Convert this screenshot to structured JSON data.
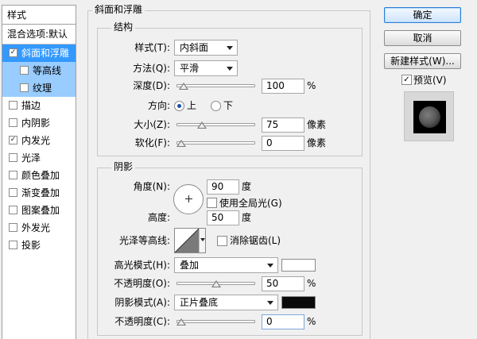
{
  "left_panel": {
    "title": "样式",
    "blend_options": "混合选项:默认",
    "items": [
      {
        "label": "斜面和浮雕",
        "checked": true,
        "selected": true,
        "sub": false
      },
      {
        "label": "等高线",
        "checked": false,
        "selected": false,
        "sub": true
      },
      {
        "label": "纹理",
        "checked": false,
        "selected": false,
        "sub": true
      },
      {
        "label": "描边",
        "checked": false,
        "selected": false,
        "sub": false
      },
      {
        "label": "内阴影",
        "checked": false,
        "selected": false,
        "sub": false
      },
      {
        "label": "内发光",
        "checked": true,
        "selected": false,
        "sub": false
      },
      {
        "label": "光泽",
        "checked": false,
        "selected": false,
        "sub": false
      },
      {
        "label": "颜色叠加",
        "checked": false,
        "selected": false,
        "sub": false
      },
      {
        "label": "渐变叠加",
        "checked": false,
        "selected": false,
        "sub": false
      },
      {
        "label": "图案叠加",
        "checked": false,
        "selected": false,
        "sub": false
      },
      {
        "label": "外发光",
        "checked": false,
        "selected": false,
        "sub": false
      },
      {
        "label": "投影",
        "checked": false,
        "selected": false,
        "sub": false
      }
    ]
  },
  "bevel": {
    "title": "斜面和浮雕",
    "structure": {
      "title": "结构",
      "style_label": "样式(T):",
      "style_value": "内斜面",
      "technique_label": "方法(Q):",
      "technique_value": "平滑",
      "depth_label": "深度(D):",
      "depth_value": "100",
      "depth_unit": "%",
      "depth_slider": 0.04,
      "direction_label": "方向:",
      "direction_up": "上",
      "direction_down": "下",
      "direction_selected": "上",
      "size_label": "大小(Z):",
      "size_value": "75",
      "size_unit": "像素",
      "size_slider": 0.3,
      "soften_label": "软化(F):",
      "soften_value": "0",
      "soften_unit": "像素",
      "soften_slider": 0.0
    },
    "shading": {
      "title": "阴影",
      "angle_label": "角度(N):",
      "angle_value": "90",
      "angle_unit": "度",
      "global_light_label": "使用全局光(G)",
      "global_light_checked": false,
      "altitude_label": "高度:",
      "altitude_value": "50",
      "altitude_unit": "度",
      "gloss_contour_label": "光泽等高线:",
      "anti_aliased_label": "消除锯齿(L)",
      "anti_aliased_checked": false,
      "highlight_mode_label": "高光模式(H):",
      "highlight_mode_value": "叠加",
      "highlight_color": "#ffffff",
      "highlight_opacity_label": "不透明度(O):",
      "highlight_opacity_value": "50",
      "highlight_opacity_unit": "%",
      "highlight_opacity_slider": 0.5,
      "shadow_mode_label": "阴影模式(A):",
      "shadow_mode_value": "正片叠底",
      "shadow_color": "#0a0a0a",
      "shadow_opacity_label": "不透明度(C):",
      "shadow_opacity_value": "0",
      "shadow_opacity_unit": "%",
      "shadow_opacity_slider": 0.0
    }
  },
  "buttons": {
    "ok": "确定",
    "cancel": "取消",
    "new_style": "新建样式(W)..."
  },
  "preview": {
    "label": "预览(V)",
    "checked": true
  },
  "colors": {
    "selection": "#3399ff",
    "sub_selection": "#99ccff"
  }
}
